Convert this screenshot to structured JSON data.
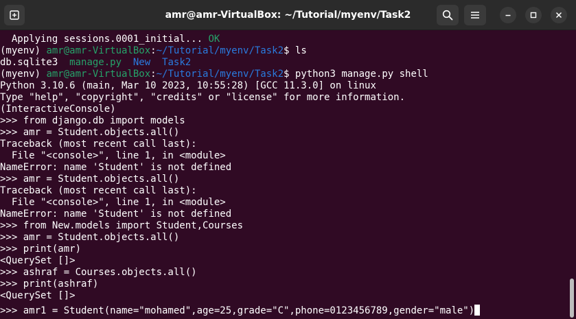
{
  "window": {
    "title": "amr@amr-VirtualBox: ~/Tutorial/myenv/Task2"
  },
  "icons": {
    "new_tab": "new-tab-icon",
    "search": "search-icon",
    "menu": "hamburger-menu-icon",
    "minimize": "minimize-icon",
    "maximize": "maximize-icon",
    "close": "close-icon"
  },
  "colors": {
    "background": "#300a24",
    "prompt_user": "#26a269",
    "prompt_path": "#2a7bde",
    "dir_listing": "#12488b",
    "ok_text": "#26a269"
  },
  "terminal": {
    "l01": {
      "pre": "  Applying sessions.0001_initial... ",
      "ok": "OK"
    },
    "l02": {
      "env": "(myenv) ",
      "user": "amr@amr-VirtualBox",
      "colon": ":",
      "path": "~/Tutorial/myenv/Task2",
      "cmd": "$ ls"
    },
    "l03": {
      "f1": "db.sqlite3",
      "sp1": "  ",
      "f2": "manage.py",
      "sp2": "  ",
      "f3": "New",
      "sp3": "  ",
      "f4": "Task2"
    },
    "l04": {
      "env": "(myenv) ",
      "user": "amr@amr-VirtualBox",
      "colon": ":",
      "path": "~/Tutorial/myenv/Task2",
      "cmd": "$ python3 manage.py shell"
    },
    "l05": "Python 3.10.6 (main, Mar 10 2023, 10:55:28) [GCC 11.3.0] on linux",
    "l06": "Type \"help\", \"copyright\", \"credits\" or \"license\" for more information.",
    "l07": "(InteractiveConsole)",
    "l08": ">>> from django.db import models",
    "l09": ">>> amr = Student.objects.all()",
    "l10": "Traceback (most recent call last):",
    "l11": "  File \"<console>\", line 1, in <module>",
    "l12": "NameError: name 'Student' is not defined",
    "l13": ">>> amr = Student.objects.all()",
    "l14": "Traceback (most recent call last):",
    "l15": "  File \"<console>\", line 1, in <module>",
    "l16": "NameError: name 'Student' is not defined",
    "l17": ">>> from New.models import Student,Courses",
    "l18": ">>> amr = Student.objects.all()",
    "l19": ">>> print(amr)",
    "l20": "<QuerySet []>",
    "l21": ">>> ashraf = Courses.objects.all()",
    "l22": ">>> print(ashraf)",
    "l23": "<QuerySet []>",
    "l24": ">>> amr1 = Student(name=\"mohamed\",age=25,grade=\"C\",phone=0123456789,gender=\"male\")"
  }
}
